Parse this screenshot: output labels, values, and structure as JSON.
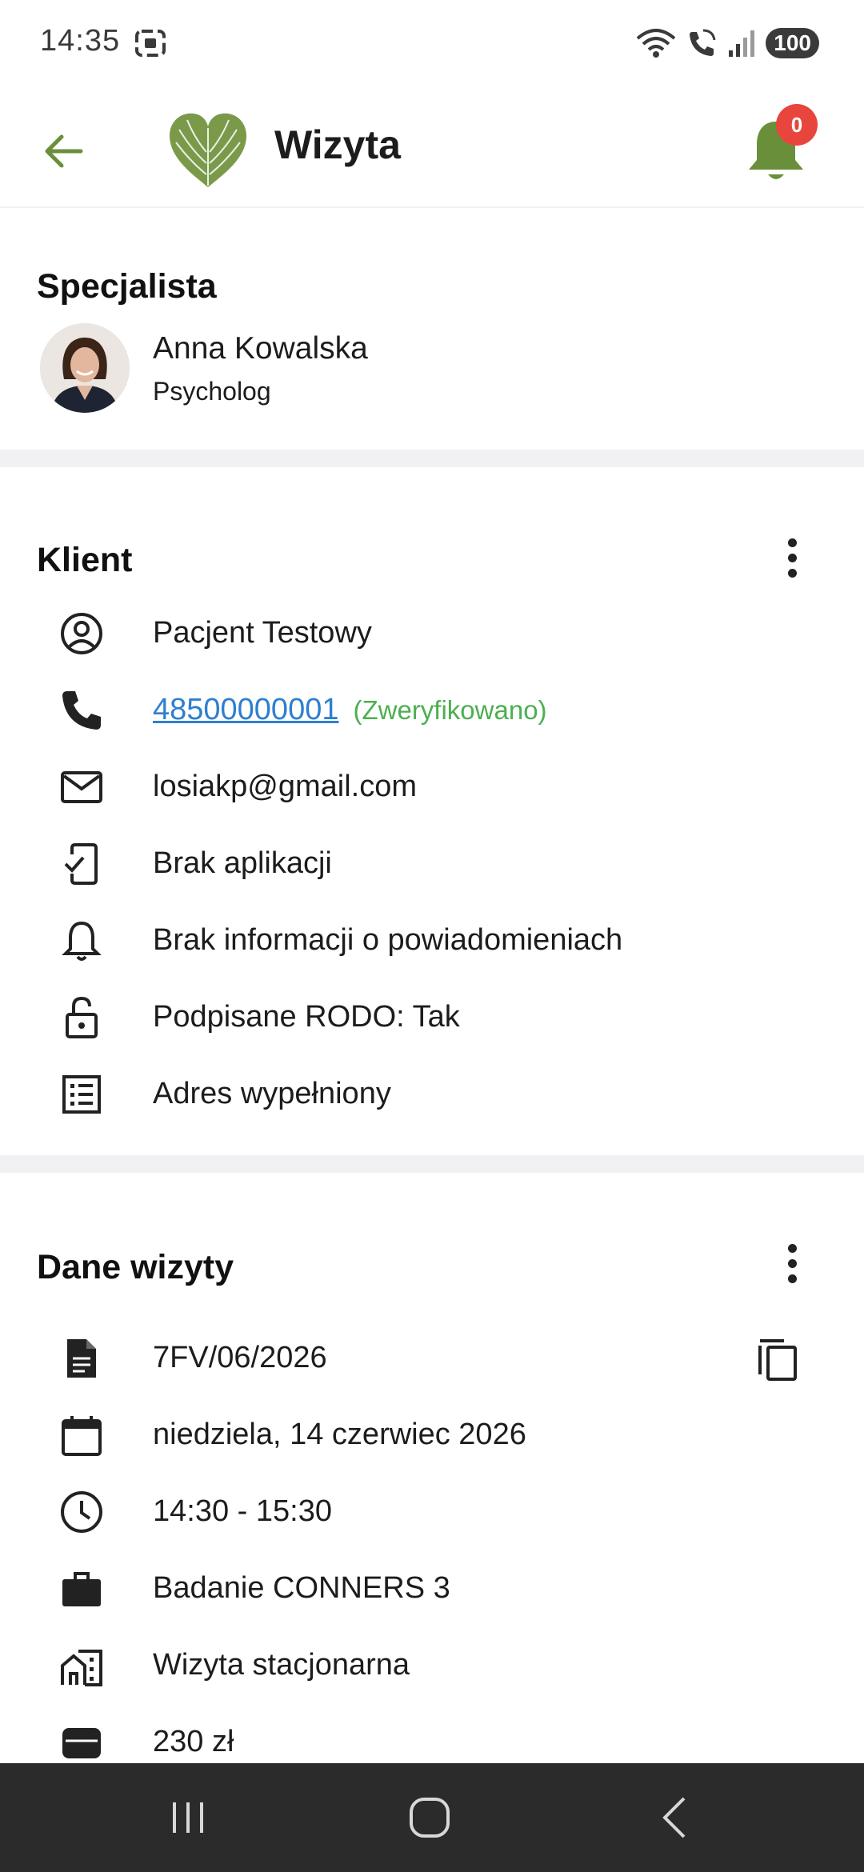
{
  "status_bar": {
    "time": "14:35",
    "battery": "100"
  },
  "app_bar": {
    "title": "Wizyta",
    "notifications_count": "0"
  },
  "specialist": {
    "section_title": "Specjalista",
    "name": "Anna Kowalska",
    "role": "Psycholog"
  },
  "client": {
    "section_title": "Klient",
    "name": "Pacjent Testowy",
    "phone": "48500000001",
    "phone_status": "(Zweryfikowano)",
    "email": "losiakp@gmail.com",
    "app_status": "Brak aplikacji",
    "notifications_status": "Brak informacji o powiadomieniach",
    "gdpr_status": "Podpisane RODO: Tak",
    "address_status": "Adres wypełniony"
  },
  "visit": {
    "section_title": "Dane wizyty",
    "number": "7FV/06/2026",
    "date": "niedziela, 14 czerwiec 2026",
    "time": "14:30 - 15:30",
    "service": "Badanie CONNERS 3",
    "type": "Wizyta stacjonarna",
    "price": "230 zł"
  },
  "colors": {
    "accent_green": "#6a8f3a",
    "badge_red": "#e8453c",
    "link_blue": "#2d7fd0",
    "verified_green": "#4caf50"
  }
}
